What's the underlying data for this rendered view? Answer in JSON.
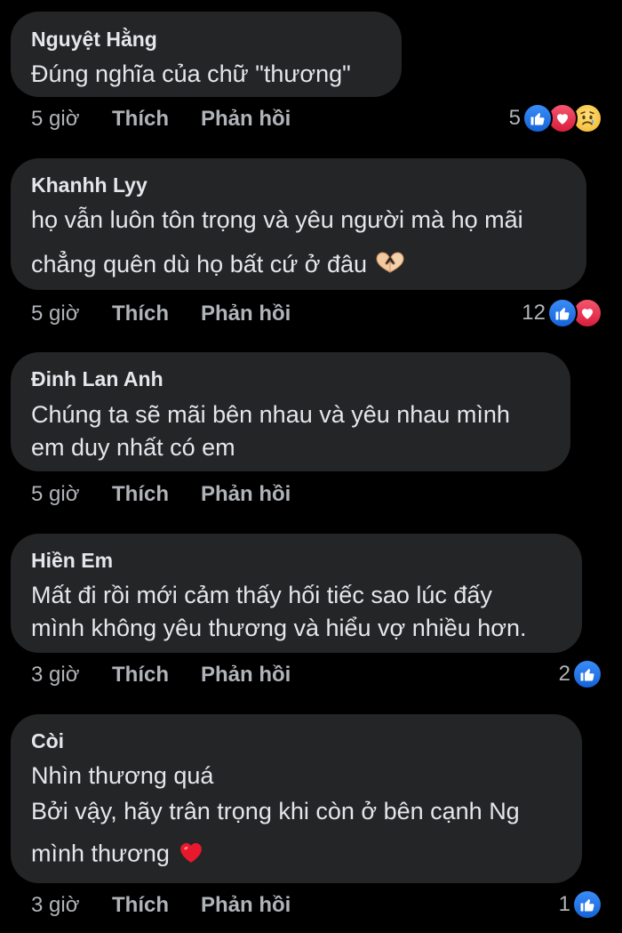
{
  "comments": [
    {
      "author": "Nguyệt Hằng",
      "lines": [
        "Đúng nghĩa của chữ \"thương\""
      ],
      "time": "5 giờ",
      "like_label": "Thích",
      "reply_label": "Phản hồi",
      "reaction_count": "5",
      "reactions": [
        "like-icon",
        "love-icon",
        "sad-icon"
      ]
    },
    {
      "author": "Khanhh Lyy",
      "lines": [
        "họ vẫn luôn tôn trọng và yêu người mà họ mãi",
        "chẳng quên dù họ bất cứ ở đâu"
      ],
      "inline_emoji": "heart-hands-emoji",
      "time": "5 giờ",
      "like_label": "Thích",
      "reply_label": "Phản hồi",
      "reaction_count": "12",
      "reactions": [
        "like-icon",
        "love-icon"
      ]
    },
    {
      "author": "Đinh Lan Anh",
      "lines": [
        "Chúng ta sẽ mãi bên nhau và yêu nhau mình",
        "em duy nhất có em"
      ],
      "time": "5 giờ",
      "like_label": "Thích",
      "reply_label": "Phản hồi"
    },
    {
      "author": "Hiền Em",
      "lines": [
        "Mất đi rồi mới cảm thấy hối tiếc sao lúc đấy",
        "mình không yêu thương và hiểu vợ nhiều hơn."
      ],
      "time": "3 giờ",
      "like_label": "Thích",
      "reply_label": "Phản hồi",
      "reaction_count": "2",
      "reactions": [
        "like-icon"
      ]
    },
    {
      "author": "Còi",
      "lines": [
        "Nhìn thương quá",
        "Bởi vậy, hãy trân trọng khi còn ở bên cạnh Ng",
        "mình thương"
      ],
      "inline_emoji": "red-heart-emoji",
      "time": "3 giờ",
      "like_label": "Thích",
      "reply_label": "Phản hồi",
      "reaction_count": "1",
      "reactions": [
        "like-icon"
      ]
    }
  ],
  "colors": {
    "background": "#000000",
    "bubble": "#242526",
    "primary_text": "#e4e6eb",
    "secondary_text": "#b0b3b8",
    "like_blue": "#1877f2",
    "love_red": "#f33e58",
    "sad_yellow": "#f7b125"
  }
}
